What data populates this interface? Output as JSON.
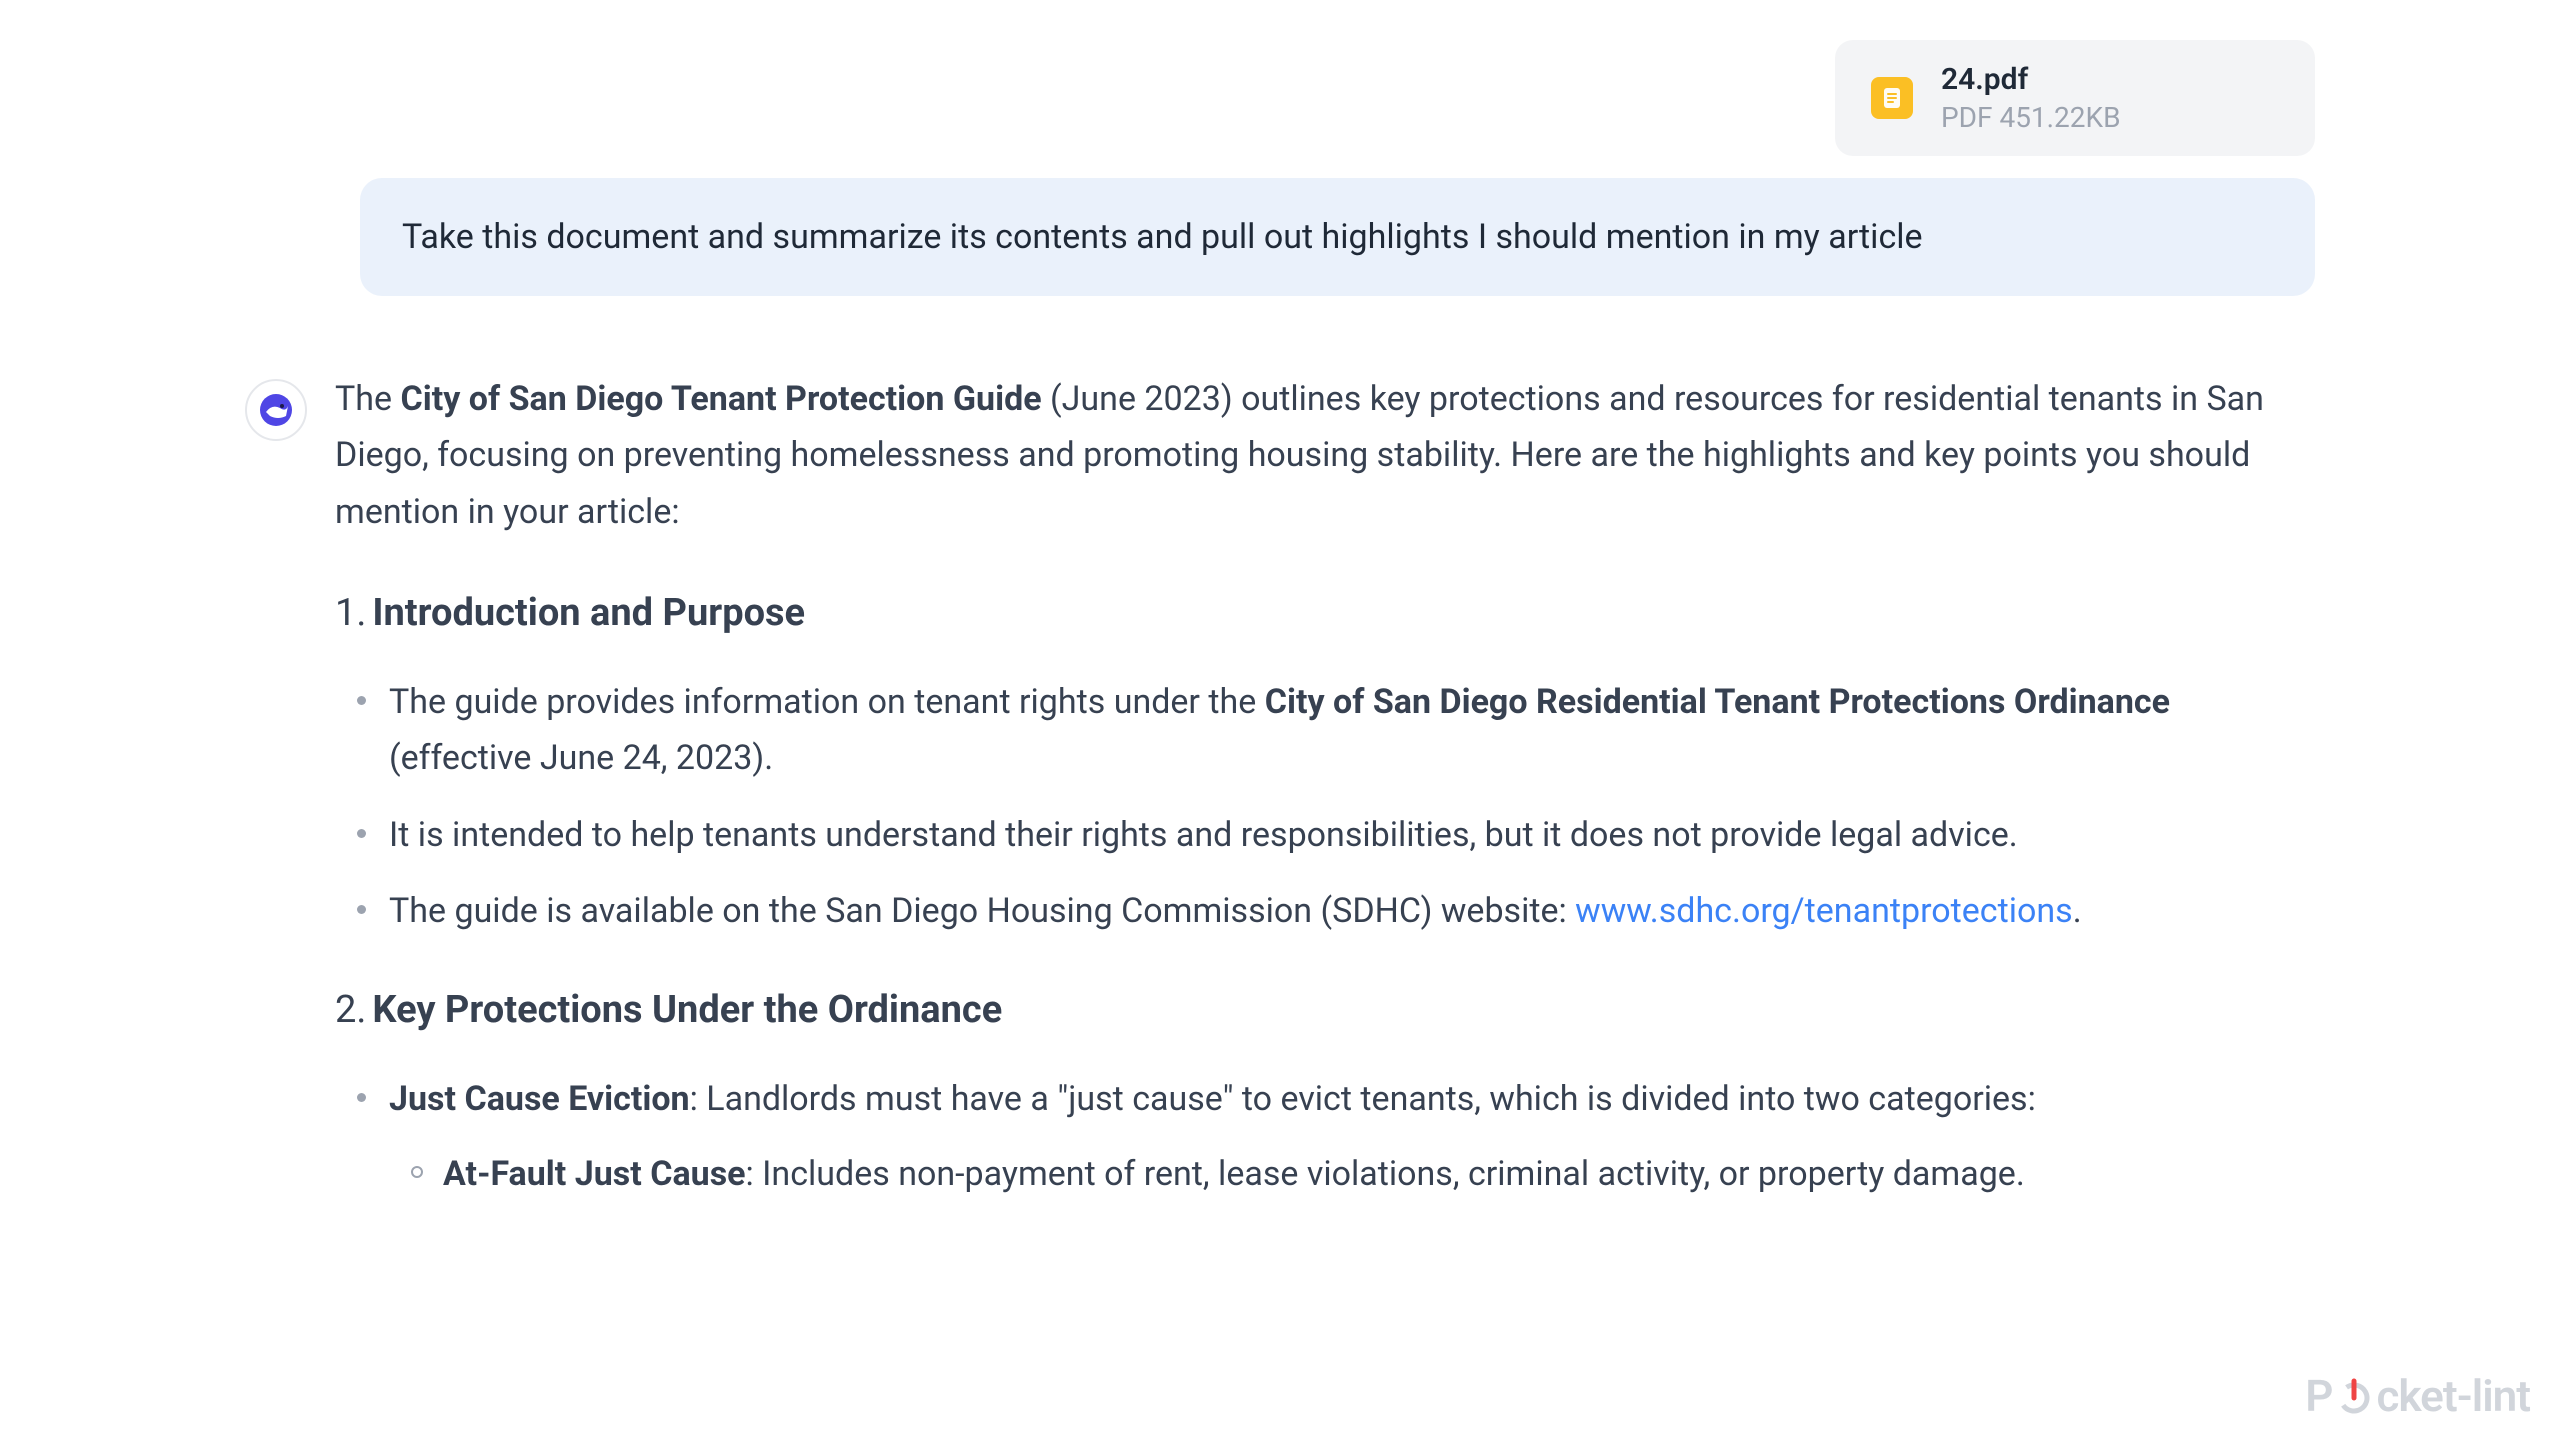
{
  "attachment": {
    "filename": "24.pdf",
    "meta": "PDF 451.22KB"
  },
  "user_message": "Take this document and summarize its contents and pull out highlights I should mention in my article",
  "response": {
    "intro_pre": "The ",
    "intro_bold": "City of San Diego Tenant Protection Guide",
    "intro_post": " (June 2023) outlines key protections and resources for residential tenants in San Diego, focusing on preventing homelessness and promoting housing stability. Here are the highlights and key points you should mention in your article:",
    "section1": {
      "num": "1.",
      "title": "Introduction and Purpose",
      "b1_pre": "The guide provides information on tenant rights under the ",
      "b1_bold": "City of San Diego Residential Tenant Protections Ordinance",
      "b1_post": " (effective June 24, 2023).",
      "b2": "It is intended to help tenants understand their rights and responsibilities, but it does not provide legal advice.",
      "b3_pre": "The guide is available on the San Diego Housing Commission (SDHC) website: ",
      "b3_link": "www.sdhc.org/tenantprotections",
      "b3_post": "."
    },
    "section2": {
      "num": "2.",
      "title": "Key Protections Under the Ordinance",
      "b1_bold": "Just Cause Eviction",
      "b1_post": ": Landlords must have a \"just cause\" to evict tenants, which is divided into two categories:",
      "sub1_bold": "At-Fault Just Cause",
      "sub1_post": ": Includes non-payment of rent, lease violations, criminal activity, or property damage."
    }
  },
  "watermark": {
    "pre": "P",
    "post": "cket-lint"
  }
}
